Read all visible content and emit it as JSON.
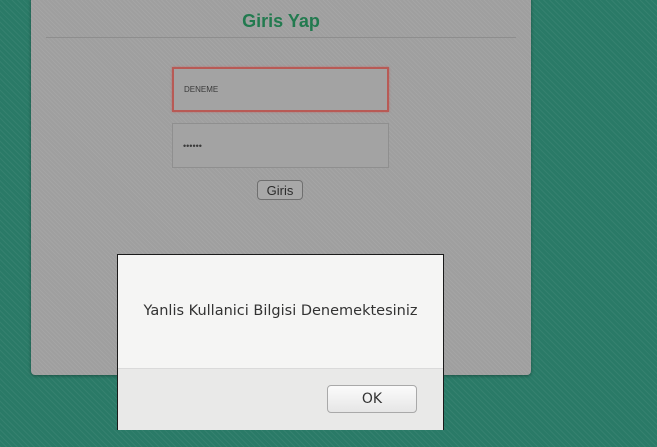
{
  "login": {
    "title": "Giris Yap",
    "username_value": "DENEME",
    "password_masked": "••••••",
    "submit_label": "Giris"
  },
  "alert": {
    "message": "Yanlis Kullanici Bilgisi Denemektesiniz",
    "ok_label": "OK"
  },
  "colors": {
    "background": "#2a7a67",
    "title": "#227a4f",
    "invalid_border": "#b85a55"
  }
}
